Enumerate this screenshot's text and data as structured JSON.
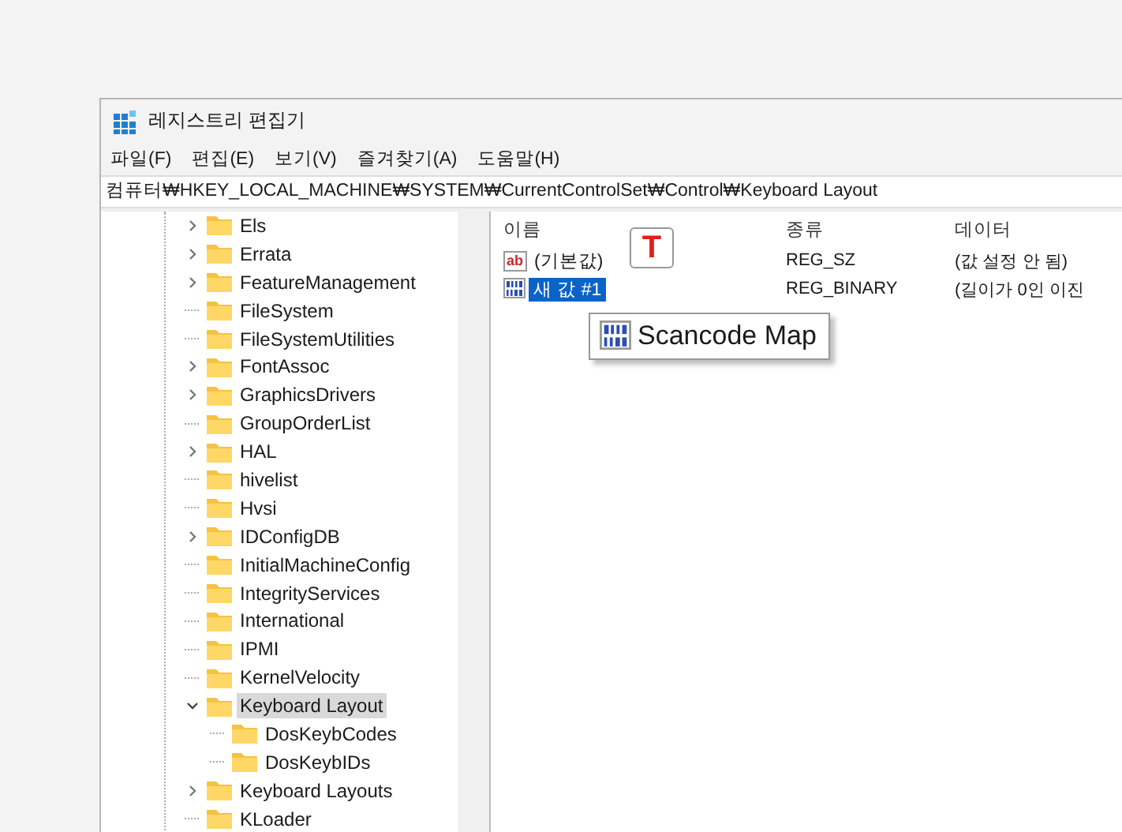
{
  "window": {
    "title": "레지스트리 편집기"
  },
  "menu": [
    "파일(F)",
    "편집(E)",
    "보기(V)",
    "즐겨찾기(A)",
    "도움말(H)"
  ],
  "address": "컴퓨터₩HKEY_LOCAL_MACHINE₩SYSTEM₩CurrentControlSet₩Control₩Keyboard Layout",
  "tree": [
    {
      "label": "Els",
      "expandable": true,
      "selected": false
    },
    {
      "label": "Errata",
      "expandable": true,
      "selected": false
    },
    {
      "label": "FeatureManagement",
      "expandable": true,
      "selected": false
    },
    {
      "label": "FileSystem",
      "expandable": false,
      "selected": false
    },
    {
      "label": "FileSystemUtilities",
      "expandable": false,
      "selected": false
    },
    {
      "label": "FontAssoc",
      "expandable": true,
      "selected": false
    },
    {
      "label": "GraphicsDrivers",
      "expandable": true,
      "selected": false
    },
    {
      "label": "GroupOrderList",
      "expandable": false,
      "selected": false
    },
    {
      "label": "HAL",
      "expandable": true,
      "selected": false
    },
    {
      "label": "hivelist",
      "expandable": false,
      "selected": false
    },
    {
      "label": "Hvsi",
      "expandable": false,
      "selected": false
    },
    {
      "label": "IDConfigDB",
      "expandable": true,
      "selected": false
    },
    {
      "label": "InitialMachineConfig",
      "expandable": false,
      "selected": false
    },
    {
      "label": "IntegrityServices",
      "expandable": false,
      "selected": false
    },
    {
      "label": "International",
      "expandable": false,
      "selected": false
    },
    {
      "label": "IPMI",
      "expandable": false,
      "selected": false
    },
    {
      "label": "KernelVelocity",
      "expandable": false,
      "selected": false
    },
    {
      "label": "Keyboard Layout",
      "expandable": true,
      "expanded": true,
      "selected": true,
      "children": [
        {
          "label": "DosKeybCodes",
          "expandable": false,
          "selected": false
        },
        {
          "label": "DosKeybIDs",
          "expandable": false,
          "selected": false
        }
      ]
    },
    {
      "label": "Keyboard Layouts",
      "expandable": true,
      "selected": false
    },
    {
      "label": "KLoader",
      "expandable": false,
      "selected": false
    }
  ],
  "columns": [
    "이름",
    "종류",
    "데이터"
  ],
  "values": [
    {
      "kind": "string",
      "icon_text": "ab",
      "name": "(기본값)",
      "type": "REG_SZ",
      "data": "(값 설정 안 됨)",
      "selected": false
    },
    {
      "kind": "binary",
      "name": "새 값 #1",
      "type": "REG_BINARY",
      "data": "(길이가 0인 이진",
      "selected": true
    }
  ],
  "typing_badge": {
    "label": "T"
  },
  "name_callout": {
    "kind": "binary",
    "text": "Scancode Map"
  }
}
